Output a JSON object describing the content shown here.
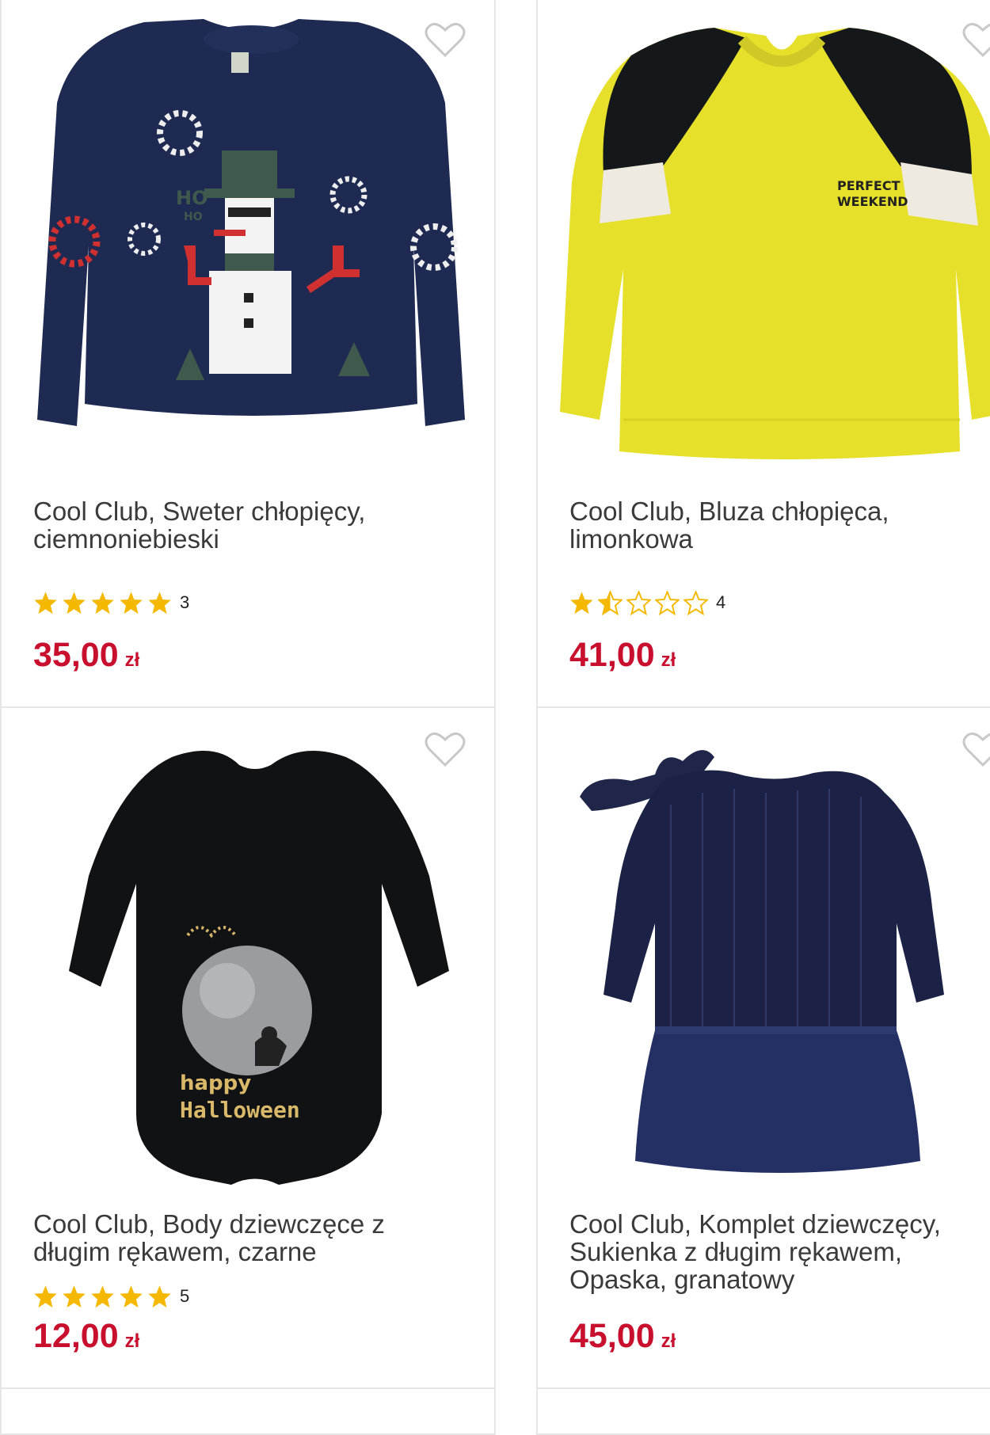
{
  "products": [
    {
      "title": "Cool Club, Sweter chłopięcy, ciemnoniebieski",
      "rating_stars": 5,
      "rating_count": "3",
      "price": "35,00",
      "currency": "zł",
      "image_icon": "navy-snowman-sweater-icon",
      "print_text": "HO HO"
    },
    {
      "title": "Cool Club, Bluza chłopięca, limonkowa",
      "rating_stars": 1.5,
      "rating_count": "4",
      "price": "41,00",
      "currency": "zł",
      "image_icon": "lime-sweatshirt-icon",
      "print_text": "PERFECT WEEKEND"
    },
    {
      "title": "Cool Club, Body dziewczęce z długim rękawem, czarne",
      "rating_stars": 5,
      "rating_count": "5",
      "price": "12,00",
      "currency": "zł",
      "image_icon": "black-halloween-bodysuit-icon",
      "print_text": "happy Halloween"
    },
    {
      "title": "Cool Club, Komplet dziewczęcy, Sukienka z długim rękawem, Opaska, granatowy",
      "rating_stars": null,
      "rating_count": null,
      "price": "45,00",
      "currency": "zł",
      "image_icon": "navy-velvet-dress-headband-icon",
      "print_text": ""
    }
  ],
  "colors": {
    "price": "#c8102e",
    "star": "#f5b800",
    "title": "#3a3a3a",
    "card_border": "#e6e6e6"
  }
}
